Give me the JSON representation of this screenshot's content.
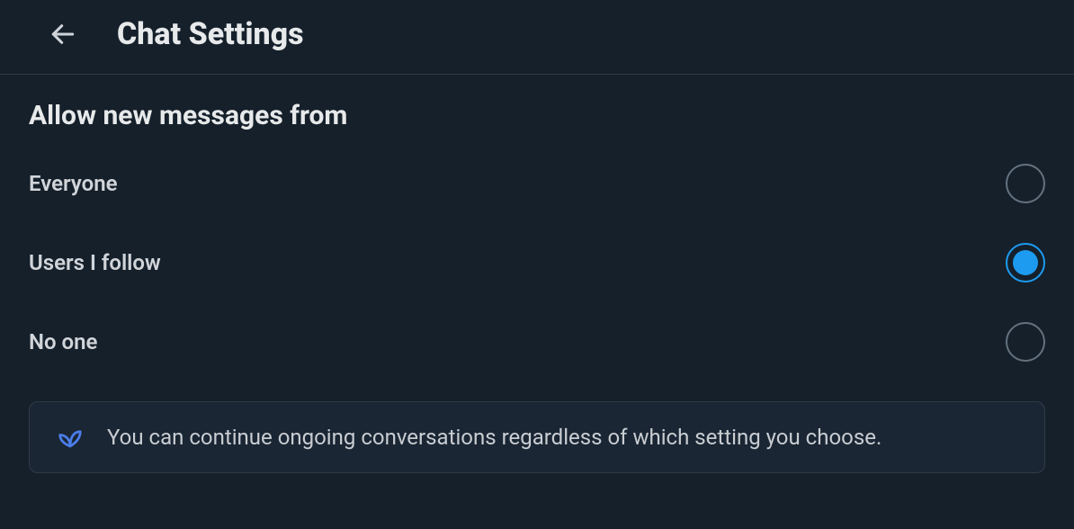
{
  "header": {
    "title": "Chat Settings"
  },
  "section": {
    "heading": "Allow new messages from",
    "options": [
      {
        "label": "Everyone",
        "selected": false
      },
      {
        "label": "Users I follow",
        "selected": true
      },
      {
        "label": "No one",
        "selected": false
      }
    ]
  },
  "info": {
    "text": "You can continue ongoing conversations regardless of which setting you choose."
  }
}
